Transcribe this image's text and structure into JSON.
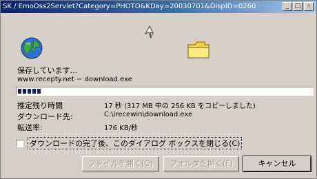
{
  "window": {
    "title": "SK / EmoOss2Servlet?Category=PHOTO&KDay=20030701&DispID=0260",
    "minimize_glyph": "_",
    "maximize_glyph": "□",
    "close_glyph": "x"
  },
  "icons": {
    "globe": "globe-icon",
    "paper": "flying-paper-icon",
    "folder": "folder-icon"
  },
  "status": {
    "text": "保存しています...",
    "source": "www.recepty.net − download.exe"
  },
  "progress": {
    "fraction": 0.07,
    "segments": 5
  },
  "details": [
    {
      "label": "推定残り時間",
      "value": "17 秒 (317 MB 中の 256 KB をコピーしました)"
    },
    {
      "label": "ダウンロード先:",
      "value": "C:\\irecewin\\download.exe"
    },
    {
      "label": "転送率:",
      "value": "176 KB/秒"
    }
  ],
  "close_on_complete": {
    "label": "ダウンロードの完了後、このダイアログ ボックスを閉じる(C)",
    "checked": false
  },
  "buttons": {
    "open": "ファイルを開く(O)",
    "open_folder": "フォルダを開く(F)",
    "cancel": "キャンセル"
  },
  "colors": {
    "title_start": "#0a246a",
    "title_end": "#a6caf0",
    "dialog_face": "#d4d0c8",
    "progress_fill": "#0a246a"
  }
}
